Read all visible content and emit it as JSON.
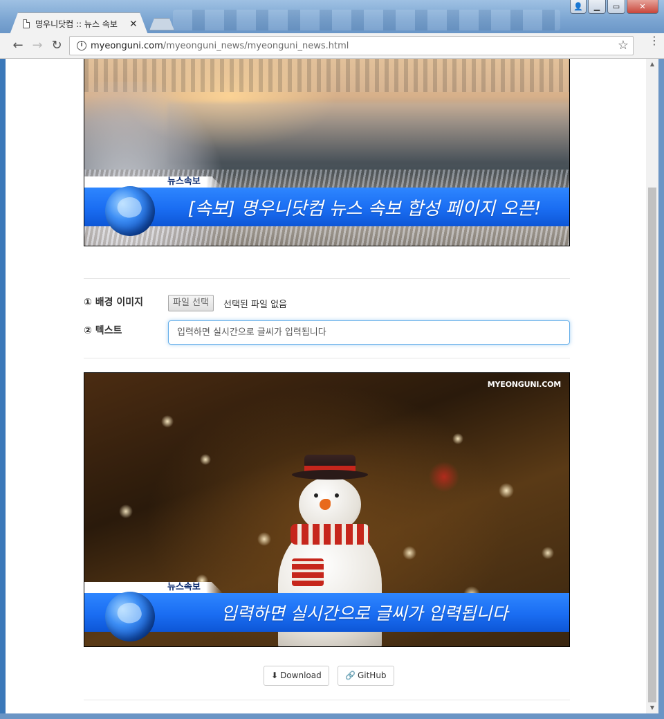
{
  "browser": {
    "tab_title": "명우니닷컴 :: 뉴스 속보",
    "url_host": "myeonguni.com",
    "url_path": "/myeonguni_news/myeonguni_news.html"
  },
  "top_preview": {
    "label": "뉴스속보",
    "headline": "[속보] 명우니닷컴 뉴스 속보 합성 페이지 오픈!"
  },
  "form": {
    "image_label": "① 배경 이미지",
    "file_button": "파일 선택",
    "file_status": "선택된 파일 없음",
    "text_label": "② 텍스트",
    "text_value": "입력하면 실시간으로 글씨가 입력됩니다"
  },
  "main_preview": {
    "watermark": "MYEONGUNI.COM",
    "label": "뉴스속보",
    "headline": "입력하면 실시간으로 글씨가 입력됩니다"
  },
  "actions": {
    "download": "Download",
    "github": "GitHub"
  },
  "icons": [
    "page-icon",
    "close-icon",
    "back-icon",
    "forward-icon",
    "reload-icon",
    "info-icon",
    "star-icon",
    "menu-icon",
    "globe-icon",
    "download-icon",
    "link-icon"
  ],
  "colors": {
    "banner_blue": "#1a6df2",
    "label_navy": "#0b2a6e",
    "input_focus": "#66afe9"
  }
}
